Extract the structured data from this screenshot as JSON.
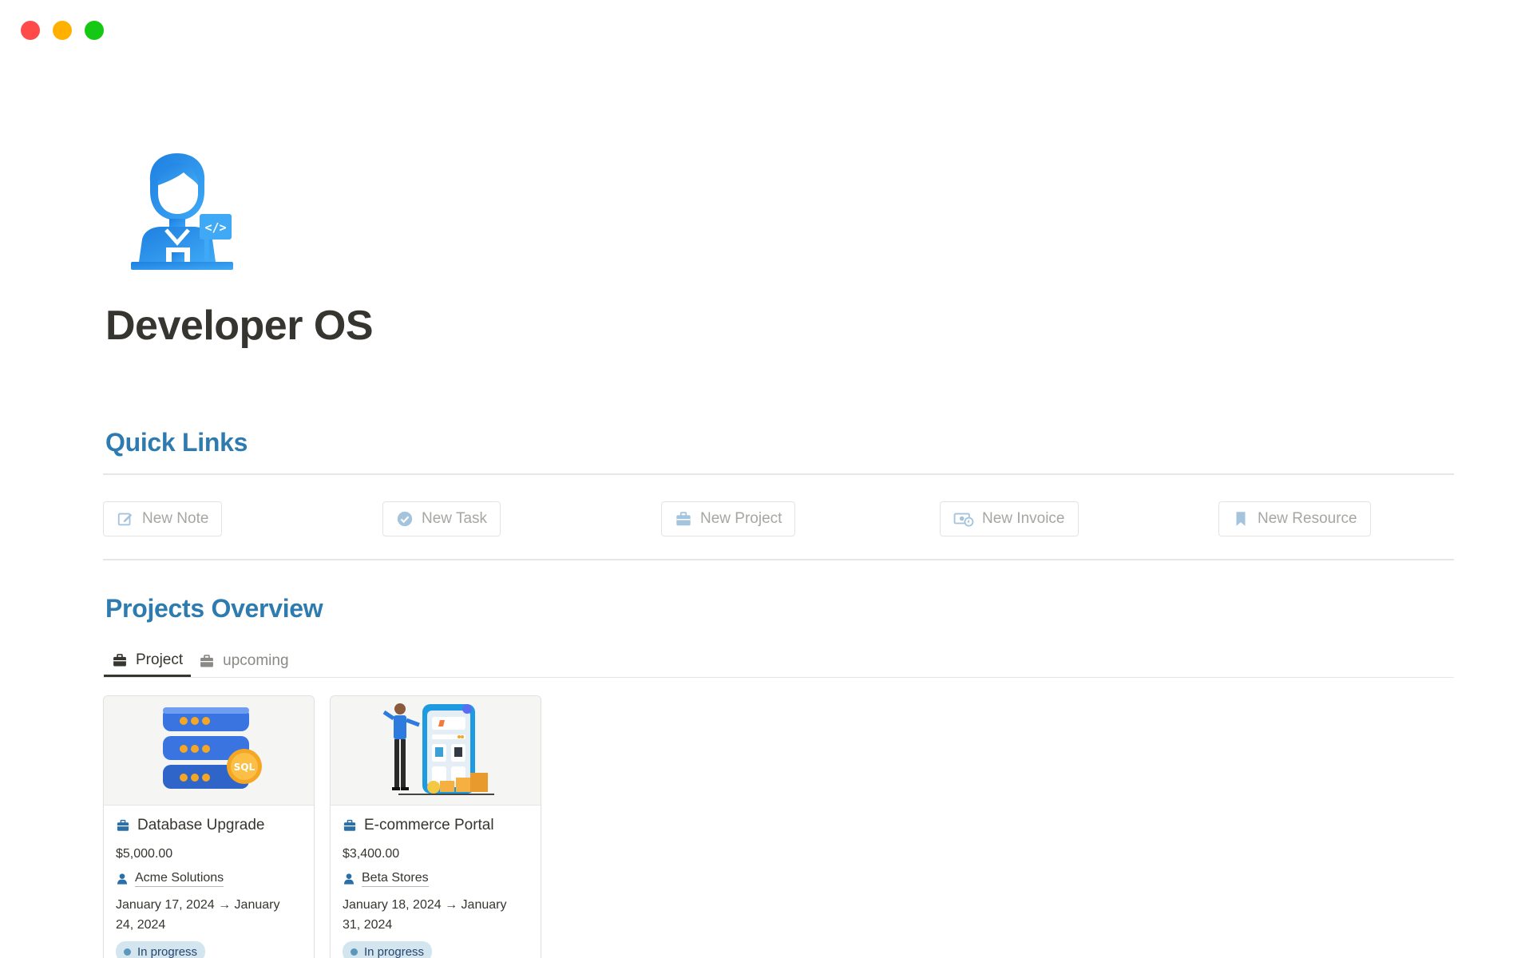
{
  "page": {
    "title": "Developer OS",
    "icon": "developer-avatar-icon"
  },
  "quick_links": {
    "heading": "Quick Links",
    "buttons": [
      {
        "label": "New Note",
        "icon": "edit-icon"
      },
      {
        "label": "New Task",
        "icon": "check-circle-icon"
      },
      {
        "label": "New Project",
        "icon": "briefcase-icon"
      },
      {
        "label": "New Invoice",
        "icon": "money-icon"
      },
      {
        "label": "New Resource",
        "icon": "bookmark-icon"
      }
    ]
  },
  "projects": {
    "heading": "Projects Overview",
    "tabs": [
      {
        "label": "Project",
        "icon": "briefcase-icon",
        "active": true
      },
      {
        "label": "upcoming",
        "icon": "briefcase-icon",
        "active": false
      }
    ],
    "cards": [
      {
        "cover": "database-sql-illustration",
        "title": "Database Upgrade",
        "price": "$5,000.00",
        "client": "Acme Solutions",
        "dates_line1": "January 17, 2024 → January",
        "dates_line2": "24, 2024",
        "status": "In progress"
      },
      {
        "cover": "ecommerce-shop-illustration",
        "title": "E-commerce Portal",
        "price": "$3,400.00",
        "client": "Beta Stores",
        "dates_line1": "January 18, 2024 → January",
        "dates_line2": "31, 2024",
        "status": "In progress"
      }
    ]
  },
  "colors": {
    "heading": "#2e7baf",
    "badge_bg": "#d3e5ef",
    "icon_blue": "#2b6fa8",
    "link_icon": "#a3c4dc"
  }
}
